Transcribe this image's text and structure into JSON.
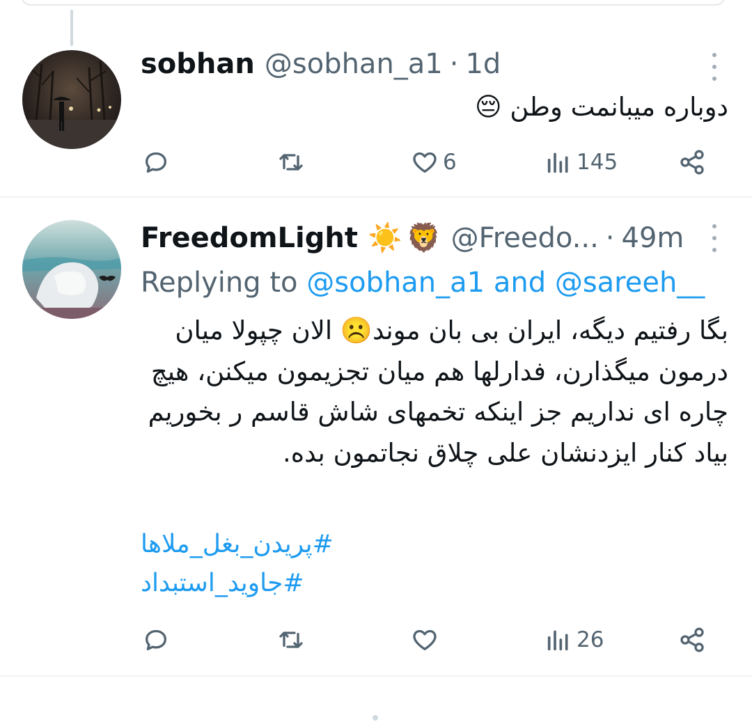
{
  "thread": {
    "tweets": [
      {
        "name": "sobhan",
        "handle": "@sobhan_a1",
        "separator": "·",
        "time": "1d",
        "text": "دوباره میبانمت وطن 😔",
        "actions": {
          "reply": "",
          "retweet": "",
          "like": "6",
          "views": "145"
        }
      },
      {
        "name": "FreedomLight",
        "badges": [
          "☀️",
          "🦁"
        ],
        "handle": "@Freedo...",
        "separator": "·",
        "time": "49m",
        "replying_prefix": "Replying to ",
        "replying_user1": "@sobhan_a1",
        "replying_and": " and ",
        "replying_user2": "@sareeh__",
        "text": "بگا رفتیم دیگه، ایران بی بان موند☹️ الان چپولا میان درمون میگذارن، فدارلها هم میان تجزیمون میکنن، هیچ چاره ای نداریم جز اینکه تخمهای شاش قاسم ر بخوریم بیاد کنار ایزدنشان علی چلاق نجاتمون بده.",
        "hashtags": [
          "#پریدن_بغل_ملاها",
          "#جاوید_استبداد"
        ],
        "actions": {
          "reply": "",
          "retweet": "",
          "like": "",
          "views": "26"
        }
      }
    ]
  },
  "icons": {
    "reply": "reply-icon",
    "retweet": "retweet-icon",
    "like": "heart-icon",
    "views": "views-icon",
    "share": "share-icon",
    "more": "more-options-icon"
  },
  "colors": {
    "text": "#0f1419",
    "secondary": "#536471",
    "link": "#1d9bf0",
    "border": "#eff3f4"
  }
}
